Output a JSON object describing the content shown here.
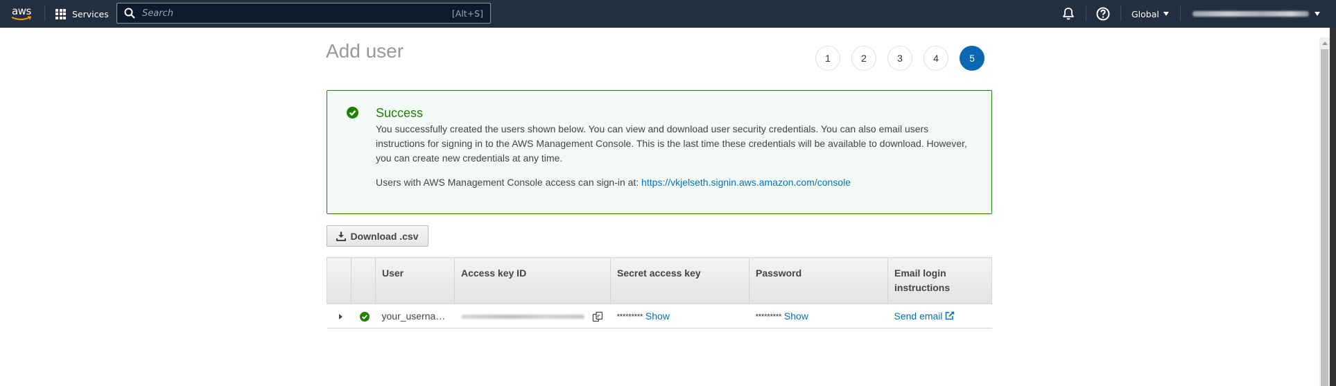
{
  "nav": {
    "logo": "aws",
    "services_label": "Services",
    "search_placeholder": "Search",
    "search_shortcut": "[Alt+S]",
    "notifications_icon": "bell-icon",
    "help_icon": "help-circle-icon",
    "region_label": "Global",
    "account_name_redacted": true
  },
  "page": {
    "title": "Add user",
    "steps": [
      {
        "label": "1",
        "active": false
      },
      {
        "label": "2",
        "active": false
      },
      {
        "label": "3",
        "active": false
      },
      {
        "label": "4",
        "active": false
      },
      {
        "label": "5",
        "active": true
      }
    ]
  },
  "alert": {
    "type": "success",
    "title": "Success",
    "message": "You successfully created the users shown below. You can view and download user security credentials. You can also email users instructions for signing in to the AWS Management Console. This is the last time these credentials will be available to download. However, you can create new credentials at any time.",
    "signin_text": "Users with AWS Management Console access can sign-in at: ",
    "signin_url": "https://vkjelseth.signin.aws.amazon.com/console",
    "color": "#1d8102"
  },
  "actions": {
    "download_label": "Download .csv"
  },
  "table": {
    "columns": [
      "",
      "",
      "User",
      "Access key ID",
      "Secret access key",
      "Password",
      "Email login instructions"
    ],
    "rows": [
      {
        "status": "success",
        "user": "your_userna…",
        "access_key_id_redacted": true,
        "secret_mask": "*********",
        "secret_action": "Show",
        "password_mask": "*********",
        "password_action": "Show",
        "email_action": "Send email"
      }
    ]
  },
  "colors": {
    "nav_bg": "#232f3e",
    "link": "#0073bb",
    "step_active": "#0a67b2",
    "success": "#1d8102"
  }
}
